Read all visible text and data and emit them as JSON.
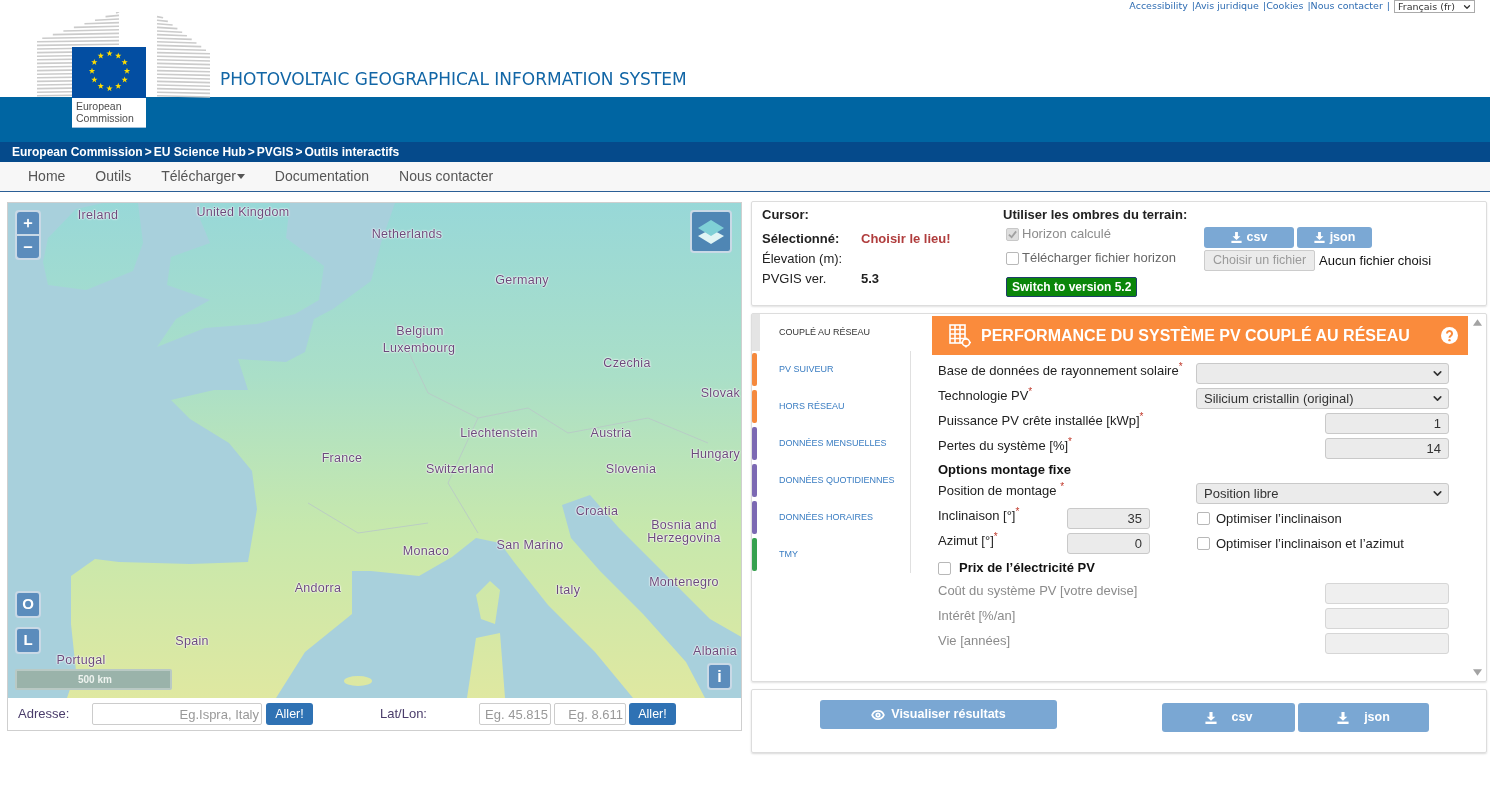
{
  "top_links": {
    "items": [
      "Accessibility",
      "Avis juridique",
      "Cookies",
      "Nous contacter"
    ],
    "separator": "|"
  },
  "language_select": {
    "value": "Français (fr)"
  },
  "header": {
    "logo_caption": "European Commission",
    "title": "PHOTOVOLTAIC GEOGRAPHICAL INFORMATION SYSTEM"
  },
  "breadcrumb": {
    "items": [
      "European Commission",
      "EU Science Hub",
      "PVGIS",
      "Outils interactifs"
    ],
    "separator": ">"
  },
  "nav": [
    {
      "label": "Home",
      "dropdown": false
    },
    {
      "label": "Outils",
      "dropdown": false
    },
    {
      "label": "Télécharger",
      "dropdown": true
    },
    {
      "label": "Documentation",
      "dropdown": false
    },
    {
      "label": "Nous contacter",
      "dropdown": false
    }
  ],
  "map": {
    "labels": [
      "Ireland",
      "United Kingdom",
      "Netherlands",
      "Germany",
      "Belgium",
      "Luxembourg",
      "Czechia",
      "Slovak",
      "Liechtenstein",
      "Austria",
      "France",
      "Switzerland",
      "Hungary",
      "Slovenia",
      "Croatia",
      "Bosnia and Herzegovina",
      "Monaco",
      "San Marino",
      "Montenegro",
      "Andorra",
      "Italy",
      "Spain",
      "Albania",
      "Portugal"
    ],
    "scale": "500 km",
    "view_buttons": [
      "O",
      "L"
    ],
    "info_button": "i"
  },
  "address_search": {
    "label": "Adresse:",
    "placeholder": "Eg.Ispra, Italy",
    "button": "Aller!"
  },
  "latlon_search": {
    "label": "Lat/Lon:",
    "fields": [
      {
        "placeholder": "Eg. 45.815"
      },
      {
        "placeholder": "Eg. 8.611"
      }
    ],
    "button": "Aller!"
  },
  "location_panel": {
    "title": "Cursor:",
    "rows": [
      {
        "kind": "prompt",
        "label": "Sélectionné:",
        "value": "Choisir le lieu!"
      },
      {
        "kind": "plain",
        "label": "Élevation (m):"
      },
      {
        "kind": "plain",
        "label": "PVGIS ver.",
        "value": "5.3"
      }
    ],
    "switch_button": "Switch to version 5.2"
  },
  "horizon": {
    "title": "Utiliser les ombres du terrain:",
    "options": [
      {
        "label": "Horizon calculé",
        "checked": true,
        "disabled": true
      },
      {
        "label": "Télécharger fichier horizon",
        "checked": false,
        "disabled": false
      }
    ],
    "downloads": [
      "csv",
      "json"
    ],
    "file_button": {
      "label": "Choisir un fichier",
      "disabled": true
    },
    "file_status": "Aucun fichier choisi"
  },
  "tabs": [
    {
      "label": "COUPLÉ AU RÉSEAU",
      "selected": true
    },
    {
      "label": "PV SUIVEUR",
      "selected": false,
      "color": "#f5893d"
    },
    {
      "label": "HORS RÉSEAU",
      "selected": false,
      "color": "#f5893d"
    },
    {
      "label": "DONNÉES MENSUELLES",
      "selected": false,
      "color": "#7c69b3"
    },
    {
      "label": "DONNÉES QUOTIDIENNES",
      "selected": false,
      "color": "#7c69b3"
    },
    {
      "label": "DONNÉES HORAIRES",
      "selected": false,
      "color": "#7c69b3"
    },
    {
      "label": "TMY",
      "selected": false,
      "color": "#36a14f"
    }
  ],
  "panel": {
    "title": "PERFORMANCE DU SYSTÈME PV COUPLÉ AU RÉSEAU",
    "fields": [
      {
        "kind": "select",
        "label": "Base de données de rayonnement solaire$^{*}$",
        "disabled": false
      },
      {
        "kind": "select",
        "label": "Technologie PV$^{*}$",
        "value": "Silicium cristallin (original)",
        "disabled": false
      },
      {
        "kind": "number",
        "label": "Puissance PV crête installée [kWp]$^{*}$",
        "value": "1",
        "disabled": false
      },
      {
        "kind": "number",
        "label": "Pertes du système [%]$^{*}$",
        "value": "14",
        "disabled": false
      },
      {
        "kind": "heading",
        "label": "Options montage fixe"
      },
      {
        "kind": "select",
        "label": "Position de montage $^{*}$",
        "value": "Position libre",
        "disabled": false
      },
      {
        "kind": "angle",
        "label": "Inclinaison [°]$^{*}$",
        "value": "35",
        "disabled": false,
        "option": {
          "label": "Optimiser l’inclinaison",
          "checked": false
        }
      },
      {
        "kind": "angle",
        "label": "Azimut [°]$^{*}$",
        "value": "0",
        "disabled": false,
        "option": {
          "label": "Optimiser l’inclinaison et l’azimut",
          "checked": false
        }
      },
      {
        "kind": "toggle",
        "label": "Prix de l’électricité PV",
        "checked": false
      },
      {
        "kind": "number",
        "label": "Coût du système PV [votre devise]",
        "disabled": true
      },
      {
        "kind": "number",
        "label": "Intérêt [%/an]",
        "disabled": true
      },
      {
        "kind": "number",
        "label": "Vie [années]",
        "disabled": true
      }
    ]
  },
  "actions": {
    "view_button": "Visualiser résultats",
    "downloads": [
      "csv",
      "json"
    ]
  }
}
